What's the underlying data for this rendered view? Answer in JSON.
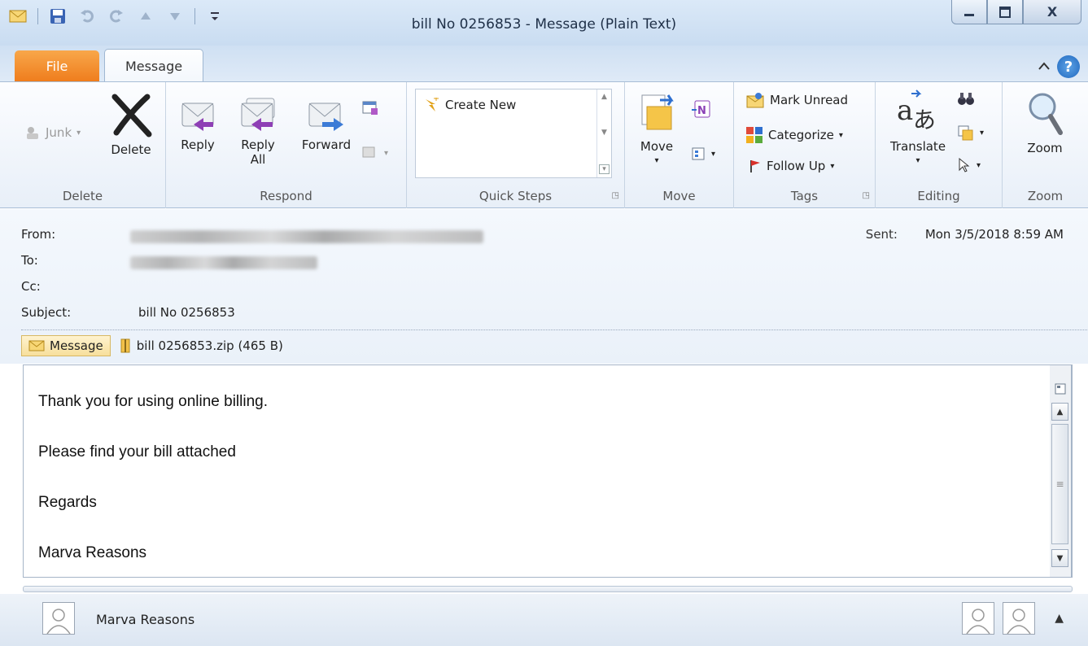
{
  "window": {
    "title": "bill No 0256853  - Message (Plain Text)",
    "close_glyph": "X"
  },
  "tabs": {
    "file": "File",
    "message": "Message"
  },
  "ribbon": {
    "delete_group": {
      "junk": "Junk",
      "delete": "Delete",
      "label": "Delete"
    },
    "respond_group": {
      "reply": "Reply",
      "reply_all_1": "Reply",
      "reply_all_2": "All",
      "forward": "Forward",
      "label": "Respond"
    },
    "quick_steps_group": {
      "create_new": "Create New",
      "label": "Quick Steps"
    },
    "move_group": {
      "move": "Move",
      "label": "Move"
    },
    "tags_group": {
      "mark_unread": "Mark Unread",
      "categorize": "Categorize",
      "follow_up": "Follow Up",
      "label": "Tags"
    },
    "editing_group": {
      "translate": "Translate",
      "label": "Editing"
    },
    "zoom_group": {
      "zoom": "Zoom",
      "label": "Zoom"
    }
  },
  "header": {
    "from_label": "From:",
    "to_label": "To:",
    "cc_label": "Cc:",
    "subject_label": "Subject:",
    "subject_value": "bill No 0256853",
    "sent_label": "Sent:",
    "sent_value": "Mon 3/5/2018 8:59 AM"
  },
  "attachments": {
    "message_tab": "Message",
    "file": "bill 0256853.zip (465 B)"
  },
  "body": {
    "line1": "Thank you for using online billing.",
    "line2": "Please find your bill attached",
    "line3": "Regards",
    "line4": "Marva Reasons"
  },
  "people_pane": {
    "name": "Marva Reasons"
  }
}
